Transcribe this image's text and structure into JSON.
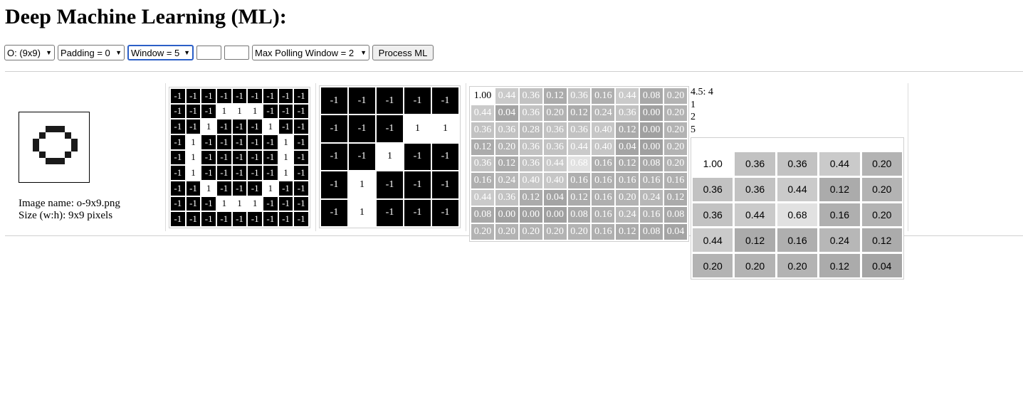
{
  "header": {
    "title": "Deep Machine Learning (ML):"
  },
  "controls": {
    "image_select": "O: (9x9)",
    "padding_select": "Padding = 0",
    "window_select": "Window = 5",
    "input_a": "",
    "input_b": "",
    "pooling_select": "Max Polling Window = 2",
    "process_button": "Process ML"
  },
  "image": {
    "name_line": "Image name: o-9x9.png",
    "size_line": "Size (w:h): 9x9 pixels",
    "pixels": [
      [
        0,
        0,
        0,
        0,
        0,
        0,
        0,
        0,
        0
      ],
      [
        0,
        0,
        0,
        1,
        1,
        1,
        0,
        0,
        0
      ],
      [
        0,
        0,
        1,
        0,
        0,
        0,
        1,
        0,
        0
      ],
      [
        0,
        1,
        0,
        0,
        0,
        0,
        0,
        1,
        0
      ],
      [
        0,
        1,
        0,
        0,
        0,
        0,
        0,
        1,
        0
      ],
      [
        0,
        0,
        1,
        0,
        0,
        0,
        1,
        0,
        0
      ],
      [
        0,
        0,
        0,
        1,
        1,
        1,
        0,
        0,
        0
      ],
      [
        0,
        0,
        0,
        0,
        0,
        0,
        0,
        0,
        0
      ],
      [
        0,
        0,
        0,
        0,
        0,
        0,
        0,
        0,
        0
      ]
    ]
  },
  "input_matrix": [
    [
      "-1",
      "-1",
      "-1",
      "-1",
      "-1",
      "-1",
      "-1",
      "-1",
      "-1"
    ],
    [
      "-1",
      "-1",
      "-1",
      "1",
      "1",
      "1",
      "-1",
      "-1",
      "-1"
    ],
    [
      "-1",
      "-1",
      "1",
      "-1",
      "-1",
      "-1",
      "1",
      "-1",
      "-1"
    ],
    [
      "-1",
      "1",
      "-1",
      "-1",
      "-1",
      "-1",
      "-1",
      "1",
      "-1"
    ],
    [
      "-1",
      "1",
      "-1",
      "-1",
      "-1",
      "-1",
      "-1",
      "1",
      "-1"
    ],
    [
      "-1",
      "1",
      "-1",
      "-1",
      "-1",
      "-1",
      "-1",
      "1",
      "-1"
    ],
    [
      "-1",
      "-1",
      "1",
      "-1",
      "-1",
      "-1",
      "1",
      "-1",
      "-1"
    ],
    [
      "-1",
      "-1",
      "-1",
      "1",
      "1",
      "1",
      "-1",
      "-1",
      "-1"
    ],
    [
      "-1",
      "-1",
      "-1",
      "-1",
      "-1",
      "-1",
      "-1",
      "-1",
      "-1"
    ]
  ],
  "filter_matrix": [
    [
      "-1",
      "-1",
      "-1",
      "-1",
      "-1"
    ],
    [
      "-1",
      "-1",
      "-1",
      "1",
      "1"
    ],
    [
      "-1",
      "-1",
      "1",
      "-1",
      "-1"
    ],
    [
      "-1",
      "1",
      "-1",
      "-1",
      "-1"
    ],
    [
      "-1",
      "1",
      "-1",
      "-1",
      "-1"
    ]
  ],
  "conv_matrix": [
    [
      "1.00",
      "0.44",
      "0.36",
      "0.12",
      "0.36",
      "0.16",
      "0.44",
      "0.08",
      "0.20"
    ],
    [
      "0.44",
      "0.04",
      "0.36",
      "0.20",
      "0.12",
      "0.24",
      "0.36",
      "0.00",
      "0.20"
    ],
    [
      "0.36",
      "0.36",
      "0.28",
      "0.36",
      "0.36",
      "0.40",
      "0.12",
      "0.00",
      "0.20"
    ],
    [
      "0.12",
      "0.20",
      "0.36",
      "0.36",
      "0.44",
      "0.40",
      "0.04",
      "0.00",
      "0.20"
    ],
    [
      "0.36",
      "0.12",
      "0.36",
      "0.44",
      "0.68",
      "0.16",
      "0.12",
      "0.08",
      "0.20"
    ],
    [
      "0.16",
      "0.24",
      "0.40",
      "0.40",
      "0.16",
      "0.16",
      "0.16",
      "0.16",
      "0.16"
    ],
    [
      "0.44",
      "0.36",
      "0.12",
      "0.04",
      "0.12",
      "0.16",
      "0.20",
      "0.24",
      "0.12"
    ],
    [
      "0.08",
      "0.00",
      "0.00",
      "0.00",
      "0.08",
      "0.16",
      "0.24",
      "0.16",
      "0.08"
    ],
    [
      "0.20",
      "0.20",
      "0.20",
      "0.20",
      "0.20",
      "0.16",
      "0.12",
      "0.08",
      "0.04"
    ]
  ],
  "pool_notes": [
    "4.5: 4",
    "1",
    "2",
    "5"
  ],
  "pool_matrix": [
    [
      "1.00",
      "0.36",
      "0.36",
      "0.44",
      "0.20"
    ],
    [
      "0.36",
      "0.36",
      "0.44",
      "0.12",
      "0.20"
    ],
    [
      "0.36",
      "0.44",
      "0.68",
      "0.16",
      "0.20"
    ],
    [
      "0.44",
      "0.12",
      "0.16",
      "0.24",
      "0.12"
    ],
    [
      "0.20",
      "0.20",
      "0.20",
      "0.12",
      "0.04"
    ]
  ]
}
